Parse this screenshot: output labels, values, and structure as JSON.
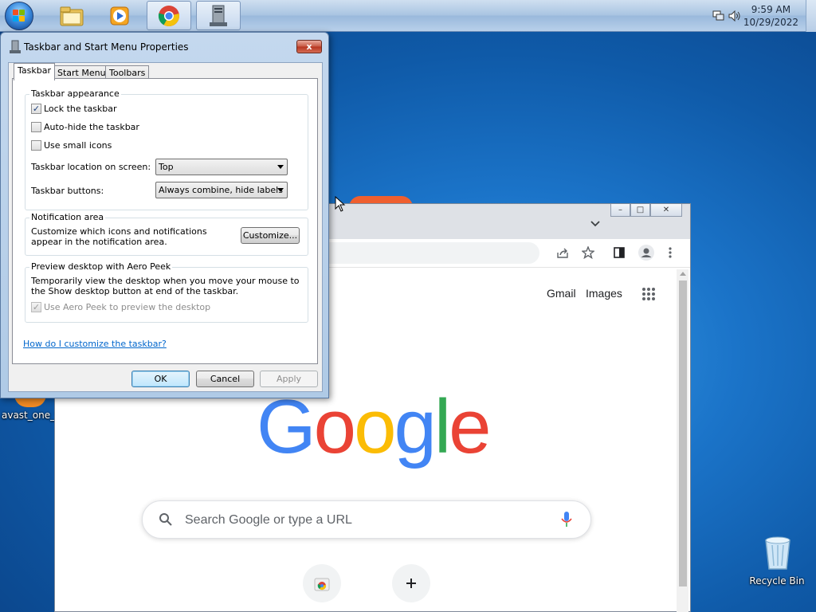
{
  "taskbar": {
    "start_icon": "windows-start-orb",
    "pinned": [
      {
        "name": "file-explorer-icon"
      },
      {
        "name": "media-player-icon"
      },
      {
        "name": "chrome-icon"
      },
      {
        "name": "control-panel-icon"
      }
    ],
    "tray": {
      "network_icon": "network-icon",
      "volume_icon": "speaker-icon"
    },
    "clock": {
      "time": "9:59 AM",
      "date": "10/29/2022"
    }
  },
  "desktop": {
    "icons": [
      {
        "label": "avast_one_f"
      },
      {
        "label": "Recycle Bin"
      }
    ]
  },
  "chrome": {
    "tab_search_icon": "chevron-down-icon",
    "toolbar_icons": [
      "share-icon",
      "star-icon",
      "side-panel-icon",
      "profile-icon",
      "more-vert-icon"
    ],
    "top_links": {
      "gmail": "Gmail",
      "images": "Images"
    },
    "apps_icon": "apps-grid-icon",
    "logo": [
      "G",
      "o",
      "o",
      "g",
      "l",
      "e"
    ],
    "logo_colors": [
      "#4285F4",
      "#EA4335",
      "#FBBC05",
      "#4285F4",
      "#34A853",
      "#EA4335"
    ],
    "search_placeholder": "Search Google or type a URL",
    "shortcuts": [
      {
        "icon": "chrome-store-icon"
      },
      {
        "icon": "plus-icon"
      }
    ]
  },
  "dialog": {
    "title": "Taskbar and Start Menu Properties",
    "close_label": "x",
    "tabs": [
      "Taskbar",
      "Start Menu",
      "Toolbars"
    ],
    "appearance": {
      "title": "Taskbar appearance",
      "lock": {
        "label": "Lock the taskbar",
        "checked": true
      },
      "autohide": {
        "label": "Auto-hide the taskbar",
        "checked": false
      },
      "small_icons": {
        "label": "Use small icons",
        "checked": false
      },
      "location_label": "Taskbar location on screen:",
      "location_value": "Top",
      "buttons_label": "Taskbar buttons:",
      "buttons_value": "Always combine, hide labels"
    },
    "notification": {
      "title": "Notification area",
      "text": "Customize which icons and notifications appear in the notification area.",
      "customize_label": "Customize..."
    },
    "aero": {
      "title": "Preview desktop with Aero Peek",
      "text": "Temporarily view the desktop when you move your mouse to the Show desktop button at end of the taskbar.",
      "checkbox_label": "Use Aero Peek to preview the desktop",
      "checked": true,
      "disabled": true
    },
    "help_link": "How do I customize the taskbar?",
    "ok_label": "OK",
    "cancel_label": "Cancel",
    "apply_label": "Apply"
  }
}
